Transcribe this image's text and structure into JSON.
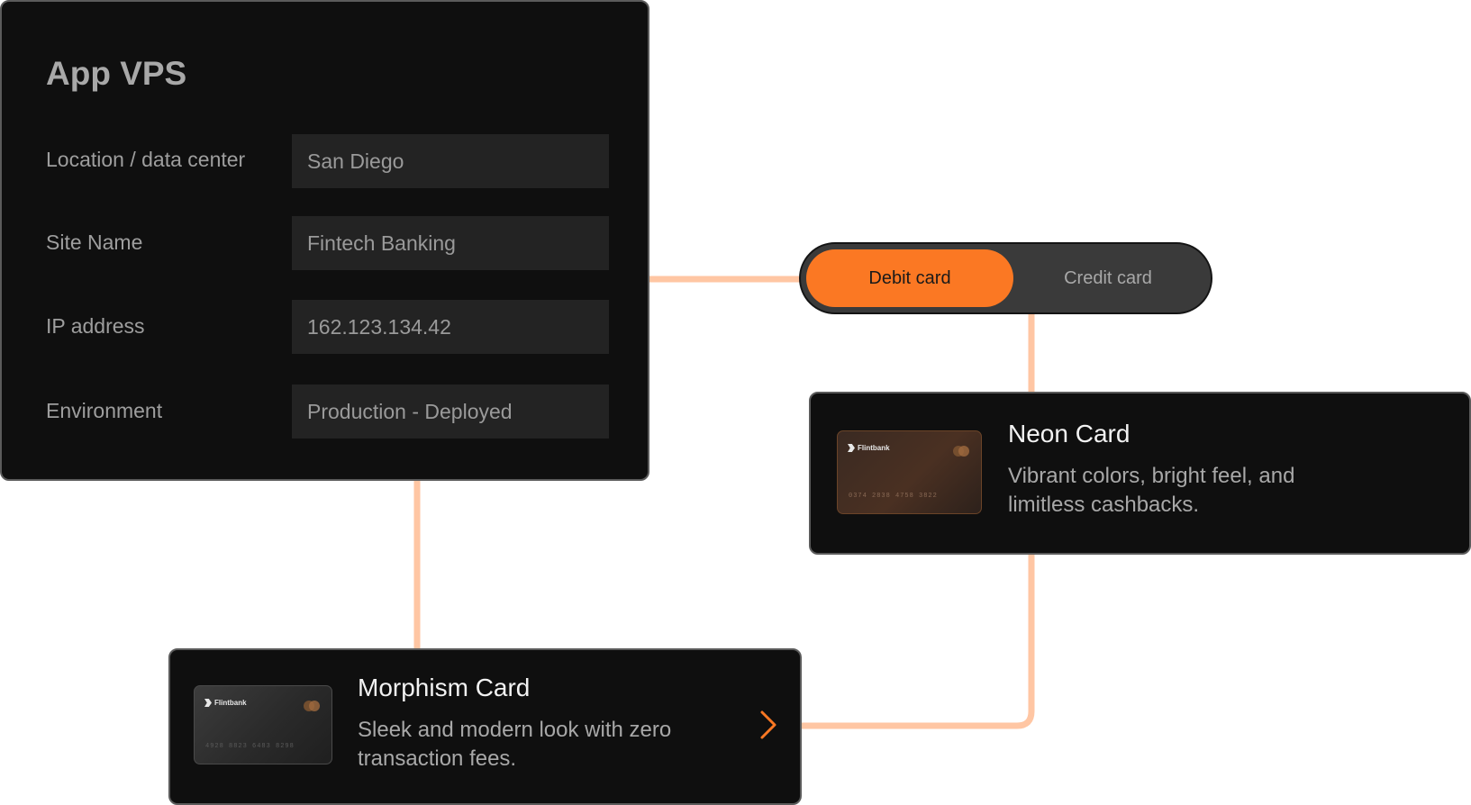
{
  "vps": {
    "title": "App VPS",
    "fields": [
      {
        "label": "Location / data center",
        "value": "San Diego"
      },
      {
        "label": "Site Name",
        "value": "Fintech Banking"
      },
      {
        "label": "IP address",
        "value": "162.123.134.42"
      },
      {
        "label": "Environment",
        "value": "Production - Deployed"
      }
    ]
  },
  "toggle": {
    "options": [
      "Debit card",
      "Credit card"
    ],
    "selected": "Debit card"
  },
  "cards": [
    {
      "title": "Neon Card",
      "description": "Vibrant colors, bright feel, and limitless cashbacks.",
      "brand": "Flintbank",
      "number": "0374 2838 4758 3822"
    },
    {
      "title": "Morphism Card",
      "description": "Sleek and modern look with zero transaction fees.",
      "brand": "Flintbank",
      "number": "4928 8823 6483 8298",
      "action_icon": "chevron-right-icon"
    }
  ],
  "colors": {
    "accent": "#fb7823",
    "connector": "#ffc6a3",
    "panel_bg": "#0f0f0f",
    "input_bg": "#232323"
  }
}
